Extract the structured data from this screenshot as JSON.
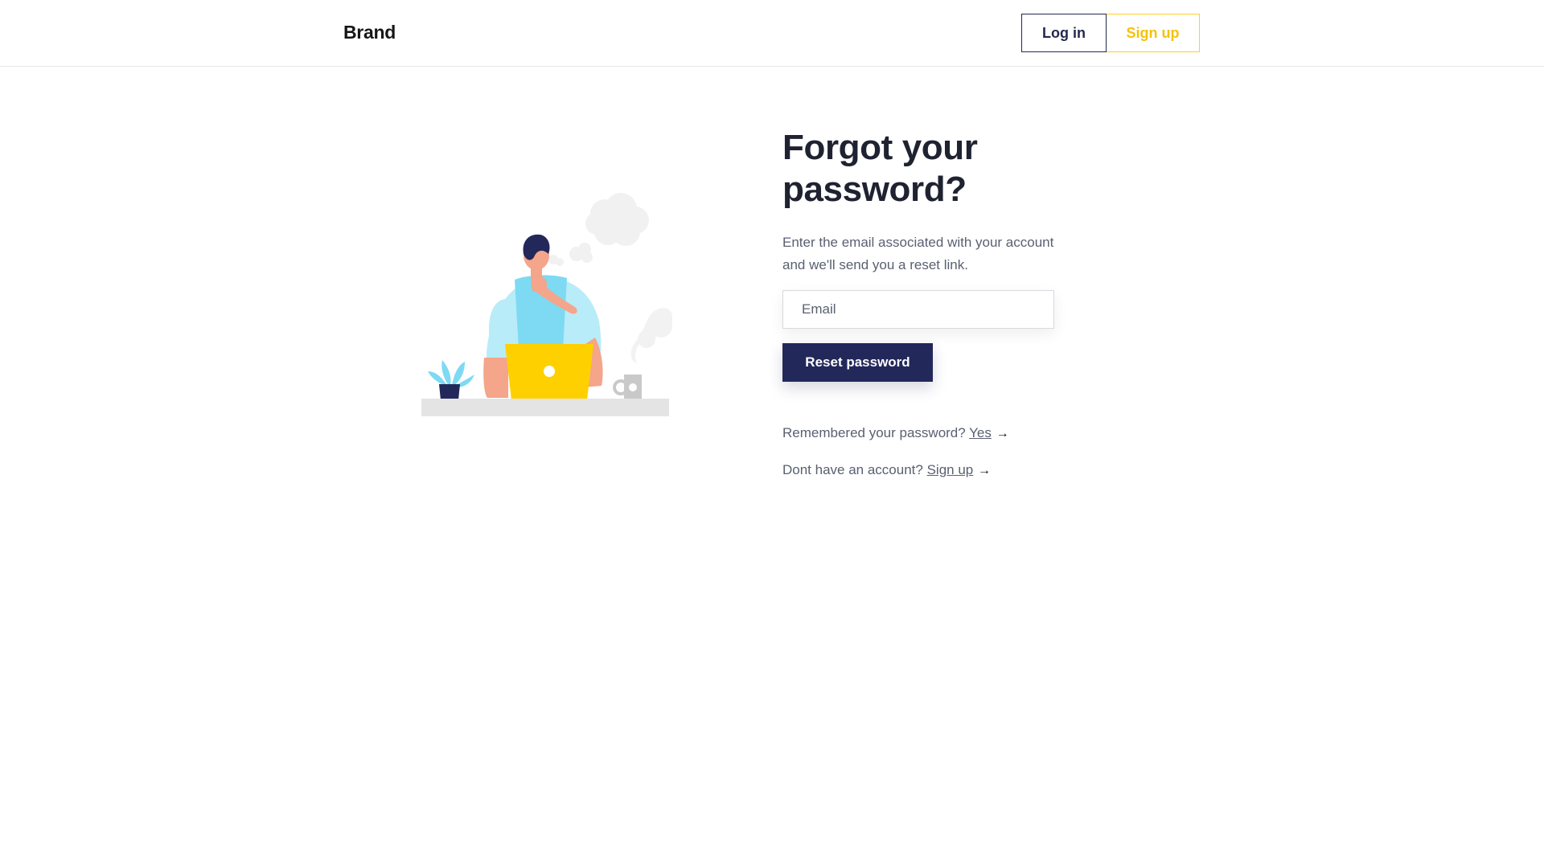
{
  "header": {
    "brand": "Brand",
    "login_label": "Log in",
    "signup_label": "Sign up"
  },
  "main": {
    "title_line1": "Forgot your",
    "title_highlight": "password",
    "title_end": "?",
    "description": "Enter the email associated with your account and we'll send you a reset link.",
    "email_placeholder": "Email",
    "email_value": "",
    "reset_button": "Reset password",
    "remembered_text": "Remembered your password?",
    "remembered_link": "Yes",
    "no_account_text": "Dont have an account?",
    "no_account_link": "Sign up",
    "arrow": "→"
  },
  "colors": {
    "primary": "#23285a",
    "accent": "#ffd000",
    "text": "#1f2230",
    "muted": "#5a6072"
  }
}
